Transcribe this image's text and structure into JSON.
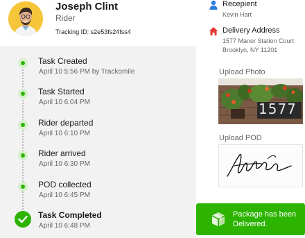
{
  "rider": {
    "name": "Joseph Clint",
    "role": "Rider",
    "tracking_id": "Tracking ID: s2e53fs24fss4"
  },
  "timeline": [
    {
      "title": "Task Created",
      "time": "April 10 5:56 PM by Trackomile",
      "completed_final": false
    },
    {
      "title": "Task Started",
      "time": "April 10 6:04 PM",
      "completed_final": false
    },
    {
      "title": "Rider departed",
      "time": "April 10 6:10 PM",
      "completed_final": false
    },
    {
      "title": "Rider arrived",
      "time": "April 10 6:30 PM",
      "completed_final": false
    },
    {
      "title": "POD collected",
      "time": "April 10 6:45 PM",
      "completed_final": false
    },
    {
      "title": "Task Completed",
      "time": "April 10 6:48 PM",
      "completed_final": true
    }
  ],
  "recipient": {
    "label": "Recepient",
    "name": "Kevin Hart"
  },
  "delivery": {
    "label": "Delivery Address",
    "line1": "1577 Manor Station Court",
    "line2": "Brooklyn, NY 11201"
  },
  "upload_photo": {
    "label": "Upload Photo",
    "house_number": "1577"
  },
  "upload_pod": {
    "label": "Upload POD"
  },
  "status": {
    "text": "Package has been Delivered."
  },
  "colors": {
    "accent_green": "#2db400",
    "timeline_bg": "#f2f2f2",
    "recipient_icon": "#2a7de1",
    "address_icon": "#e53935"
  },
  "icons": {
    "recipient": "person-icon",
    "address": "home-icon",
    "delivered": "package-icon",
    "final_step": "check-circle-icon"
  }
}
